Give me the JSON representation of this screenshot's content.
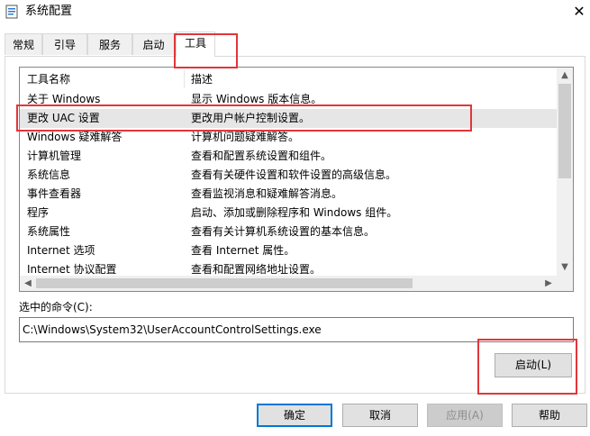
{
  "window": {
    "title": "系统配置",
    "close_glyph": "✕"
  },
  "tabs": [
    {
      "label": "常规"
    },
    {
      "label": "引导"
    },
    {
      "label": "服务"
    },
    {
      "label": "启动"
    },
    {
      "label": "工具",
      "active": true
    }
  ],
  "list": {
    "headers": {
      "name": "工具名称",
      "desc": "描述"
    },
    "rows": [
      {
        "name": "关于 Windows",
        "desc": "显示 Windows 版本信息。"
      },
      {
        "name": "更改 UAC 设置",
        "desc": "更改用户帐户控制设置。",
        "selected": true
      },
      {
        "name": "Windows 疑难解答",
        "desc": "计算机问题疑难解答。"
      },
      {
        "name": "计算机管理",
        "desc": "查看和配置系统设置和组件。"
      },
      {
        "name": "系统信息",
        "desc": "查看有关硬件设置和软件设置的高级信息。"
      },
      {
        "name": "事件查看器",
        "desc": "查看监视消息和疑难解答消息。"
      },
      {
        "name": "程序",
        "desc": "启动、添加或删除程序和 Windows 组件。"
      },
      {
        "name": "系统属性",
        "desc": "查看有关计算机系统设置的基本信息。"
      },
      {
        "name": "Internet 选项",
        "desc": "查看 Internet 属性。"
      },
      {
        "name": "Internet 协议配置",
        "desc": "查看和配置网络地址设置。"
      }
    ]
  },
  "command": {
    "label": "选中的命令(C):",
    "value": "C:\\Windows\\System32\\UserAccountControlSettings.exe"
  },
  "buttons": {
    "launch": "启动(L)",
    "ok": "确定",
    "cancel": "取消",
    "apply": "应用(A)",
    "help": "帮助"
  },
  "colors": {
    "highlight": "#e2363a",
    "selected_row": "#e6e6e6",
    "accent": "#0078d7"
  },
  "icons": {
    "app": "msconfig-icon",
    "close": "close-icon"
  }
}
